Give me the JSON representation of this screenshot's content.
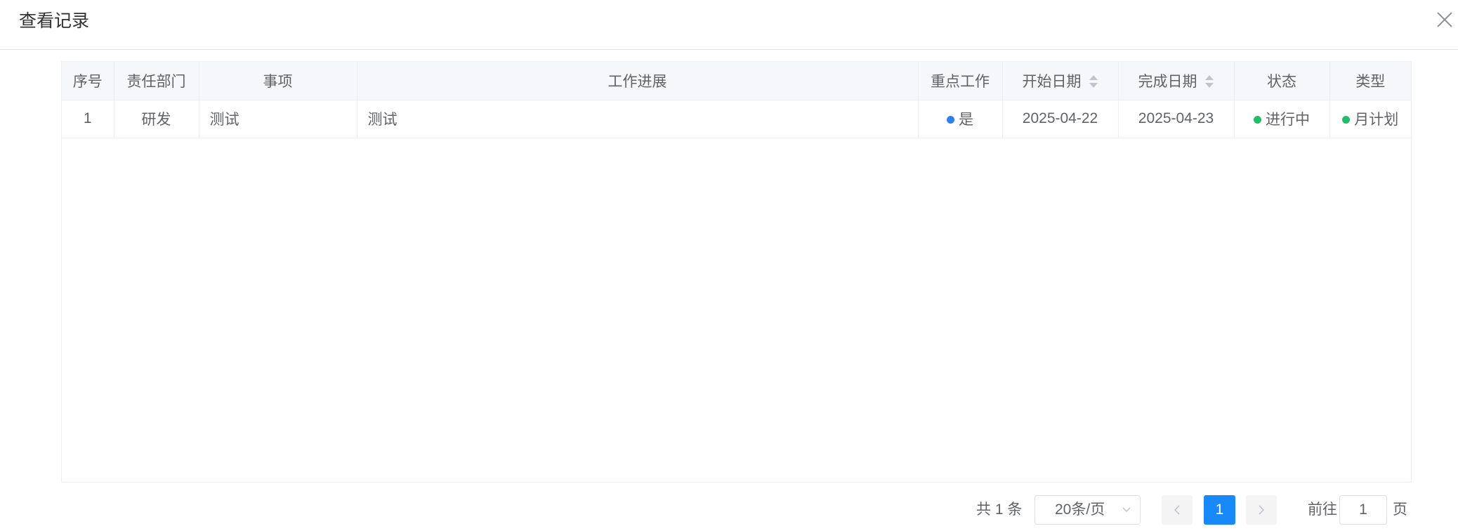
{
  "dialog": {
    "title": "查看记录"
  },
  "table": {
    "headers": {
      "index": "序号",
      "dept": "责任部门",
      "item": "事项",
      "progress": "工作进展",
      "key": "重点工作",
      "start": "开始日期",
      "end": "完成日期",
      "status": "状态",
      "type": "类型"
    },
    "rows": [
      {
        "index": "1",
        "dept": "研发",
        "item": "测试",
        "progress": "测试",
        "key": "是",
        "start": "2025-04-22",
        "end": "2025-04-23",
        "status": "进行中",
        "type": "月计划"
      }
    ]
  },
  "pagination": {
    "total": "共 1 条",
    "page_size": "20条/页",
    "current_page": "1",
    "goto_label": "前往",
    "goto_value": "1",
    "goto_suffix": "页"
  },
  "colors": {
    "accent": "#1989fa",
    "key_dot": "#2f80ed",
    "status_dot": "#1fbf6a"
  },
  "icons": [
    "close-icon",
    "sort-caret-icon",
    "chevron-down-icon",
    "chevron-left-icon",
    "chevron-right-icon"
  ]
}
